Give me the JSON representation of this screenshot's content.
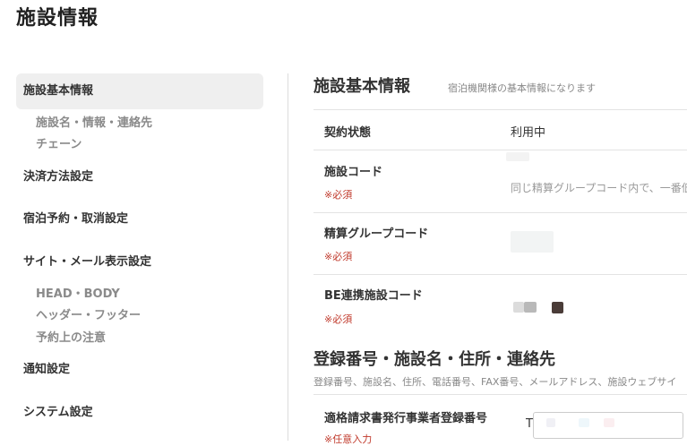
{
  "page_title": "施設情報",
  "sidebar": {
    "items": [
      {
        "label": "施設基本情報",
        "active": true
      },
      {
        "label": "決済方法設定"
      },
      {
        "label": "宿泊予約・取消設定"
      },
      {
        "label": "サイト・メール表示設定"
      },
      {
        "label": "通知設定"
      },
      {
        "label": "システム設定"
      }
    ],
    "sub_basic": [
      "施設名・情報・連絡先",
      "チェーン"
    ],
    "sub_site": [
      "HEAD・BODY",
      "ヘッダー・フッター",
      "予約上の注意"
    ]
  },
  "main": {
    "section1": {
      "title": "施設基本情報",
      "subtitle": "宿泊機関様の基本情報になります"
    },
    "rows": [
      {
        "label": "契約状態",
        "value": "利用中"
      },
      {
        "label": "施設コード",
        "required": "※必須",
        "hint": "同じ精算グループコード内で、一番低"
      },
      {
        "label": "精算グループコード",
        "required": "※必須"
      },
      {
        "label": "BE連携施設コード",
        "required": "※必須"
      }
    ],
    "section2": {
      "title": "登録番号・施設名・住所・連絡先",
      "subtitle": "登録番号、施設名、住所、電話番号、FAX番号、メールアドレス、施設ウェブサイ"
    },
    "invoice": {
      "label": "適格請求書発行事業者登録番号",
      "optional": "※任意入力",
      "prefix": "T"
    }
  },
  "colors": {
    "active_bg": "#efefef",
    "required_red": "#c0392b",
    "muted": "#8a8a8a"
  }
}
